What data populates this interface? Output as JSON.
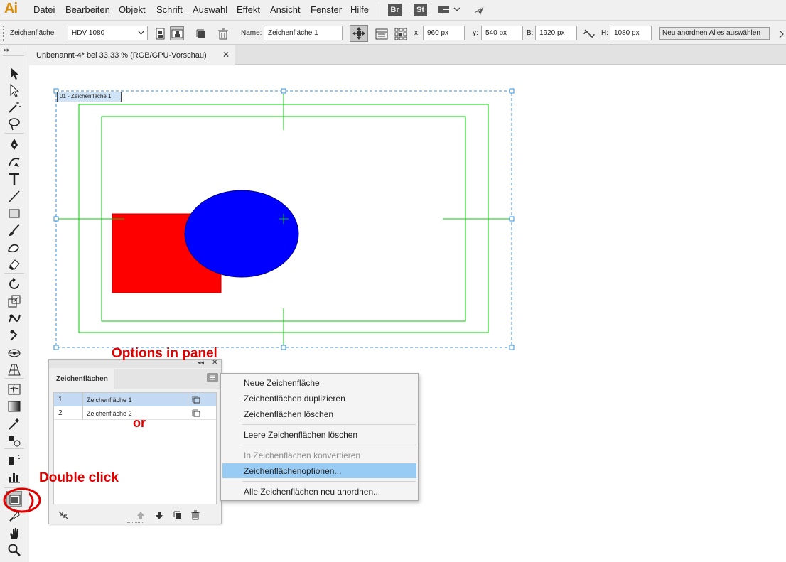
{
  "app": {
    "logo": "Ai"
  },
  "menubar": {
    "items": [
      "Datei",
      "Bearbeiten",
      "Objekt",
      "Schrift",
      "Auswahl",
      "Effekt",
      "Ansicht",
      "Fenster",
      "Hilfe"
    ],
    "bridge_label": "Br",
    "stock_label": "St"
  },
  "controlbar": {
    "tool_label": "Zeichenfläche",
    "preset_value": "HDV 1080",
    "name_label": "Name:",
    "name_value": "Zeichenfläche 1",
    "x_label": "x:",
    "x_value": "960 px",
    "y_label": "y:",
    "y_value": "540 px",
    "w_label": "B:",
    "w_value": "1920 px",
    "h_label": "H:",
    "h_value": "1080 px",
    "rearrange_label": "Neu anordnen",
    "select_all_label": "Alles auswählen"
  },
  "document": {
    "tab_title": "Unbenannt-4* bei 33.33 % (RGB/GPU-Vorschau)",
    "artboard_label": "01 - Zeichenfläche 1"
  },
  "colors": {
    "accent_orange": "#d98c00",
    "guide_green": "#00cc00",
    "rect_red": "#ff0000",
    "ellipse_blue": "#0000ff",
    "selection_blue": "#3a8fd8",
    "menu_highlight": "#99ccf5",
    "annotation_red": "#e00000"
  },
  "artboards_panel": {
    "title": "Zeichenflächen",
    "rows": [
      {
        "num": "1",
        "name": "Zeichenfläche 1",
        "selected": true
      },
      {
        "num": "2",
        "name": "Zeichenfläche 2",
        "selected": false
      }
    ]
  },
  "panel_menu": {
    "items": [
      {
        "label": "Neue Zeichenfläche",
        "disabled": false
      },
      {
        "label": "Zeichenflächen duplizieren",
        "disabled": false
      },
      {
        "label": "Zeichenflächen löschen",
        "disabled": false
      },
      {
        "label": "Leere Zeichenflächen löschen",
        "disabled": false
      },
      {
        "label": "In Zeichenflächen konvertieren",
        "disabled": true
      },
      {
        "label": "Zeichenflächenoptionen...",
        "disabled": false,
        "highlighted": true
      },
      {
        "label": "Alle Zeichenflächen neu anordnen...",
        "disabled": false
      }
    ]
  },
  "annotations": {
    "options_in_panel": "Options in panel",
    "or": "or",
    "double_click": "Double click"
  },
  "tools": [
    "selection-tool-icon",
    "direct-selection-tool-icon",
    "magic-wand-icon",
    "lasso-icon",
    "pen-icon",
    "curvature-icon",
    "type-icon",
    "line-icon",
    "rectangle-icon",
    "paintbrush-icon",
    "shaper-icon",
    "eraser-icon",
    "rotate-icon",
    "scale-icon",
    "warp-icon",
    "puppet-warp-icon",
    "free-transform-icon",
    "perspective-grid-icon",
    "mesh-icon",
    "gradient-icon",
    "eyedropper-icon",
    "blend-icon",
    "symbol-sprayer-icon",
    "column-graph-icon",
    "artboard-tool-icon",
    "slice-icon",
    "hand-icon",
    "zoom-icon"
  ]
}
